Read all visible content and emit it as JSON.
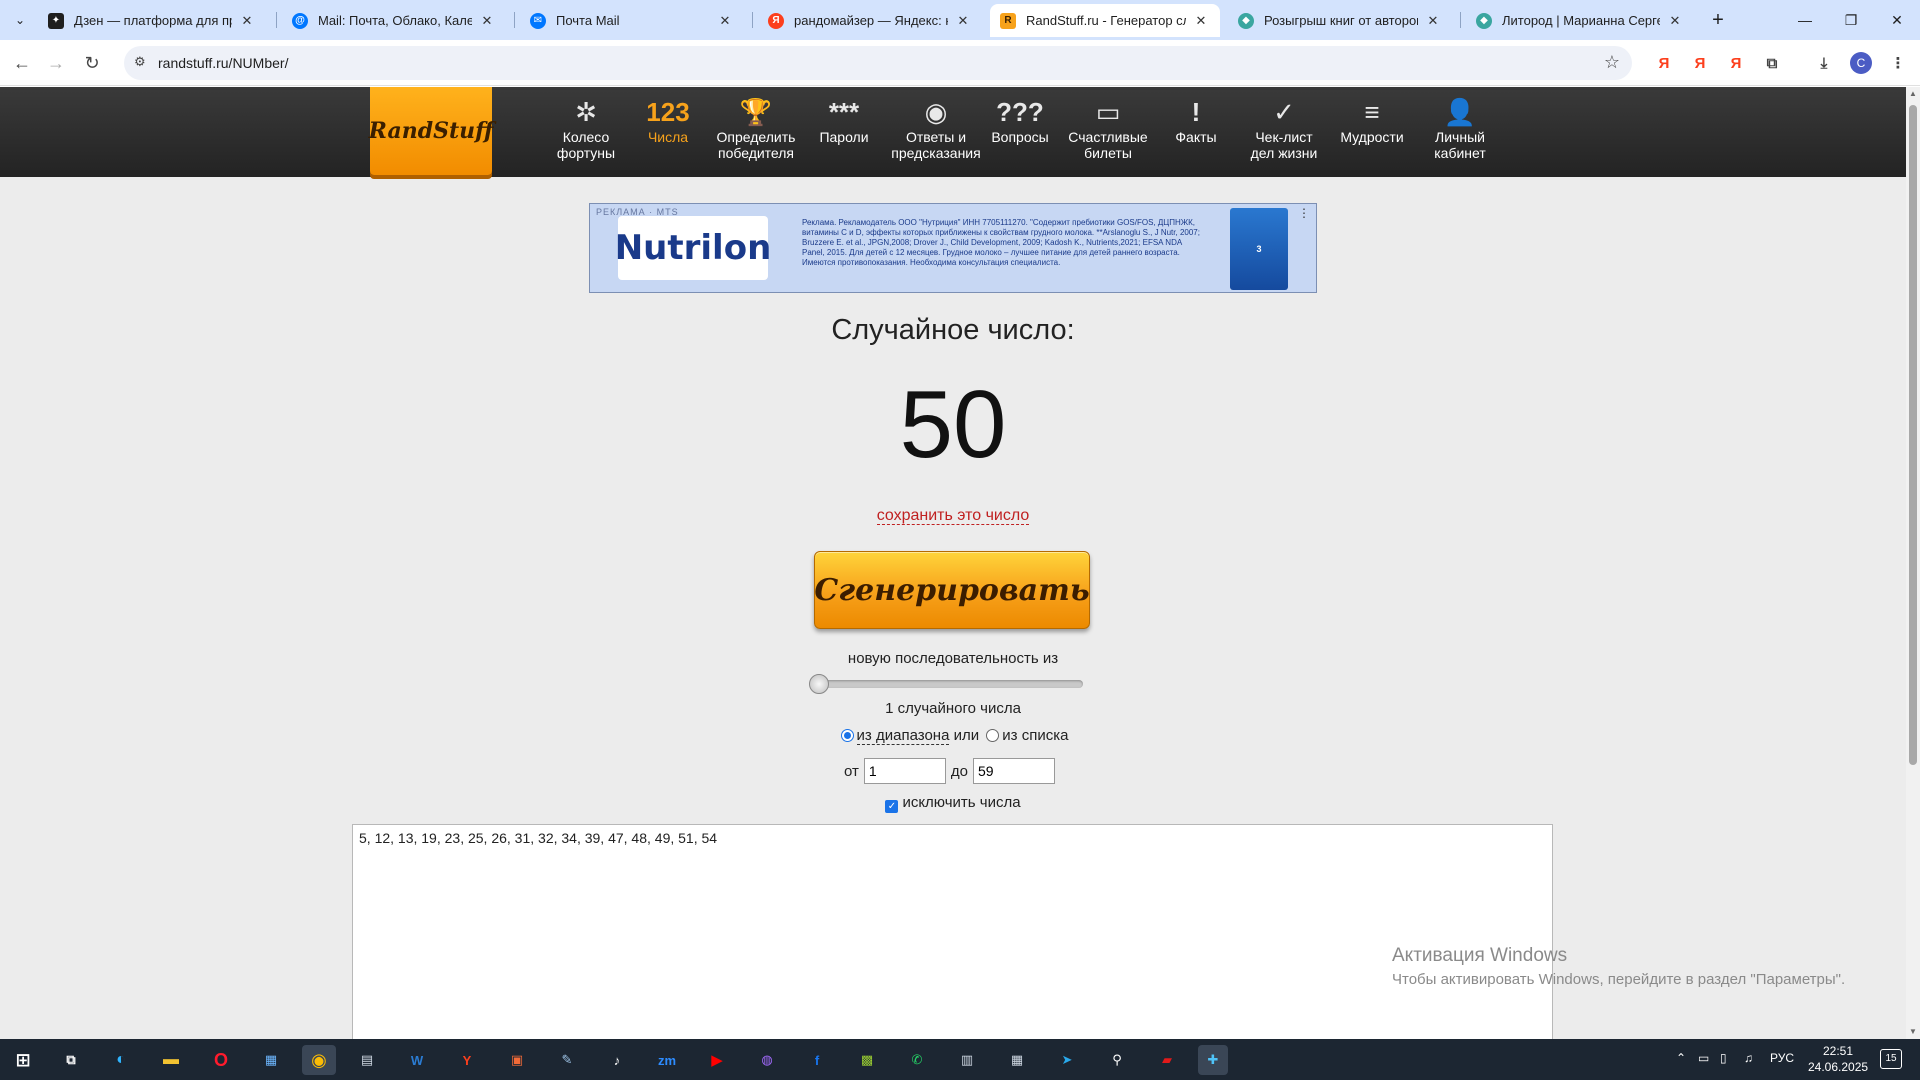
{
  "browser": {
    "tabs": [
      {
        "title": "Дзен — платформа для просм",
        "favicon": "zen-icon",
        "color": "#1f1f1f"
      },
      {
        "title": "Mail: Почта, Облако, Календар",
        "favicon": "mail-at-icon",
        "color": "#0077ff"
      },
      {
        "title": "Почта Mail",
        "favicon": "mail-envelope-icon",
        "color": "#0077ff"
      },
      {
        "title": "рандомайзер — Яндекс: нашл",
        "favicon": "yandex-icon",
        "color": "#fc3f1d"
      },
      {
        "title": "RandStuff.ru - Генератор случа",
        "favicon": "randstuff-icon",
        "color": "#f7a21b"
      },
      {
        "title": "Розыгрыш книг от авторов Ли",
        "favicon": "litres-icon",
        "color": "#3aa6a0"
      },
      {
        "title": "Литород | Марианна Сергеев",
        "favicon": "litres-icon",
        "color": "#3aa6a0"
      }
    ],
    "url": "randstuff.ru/NUMber/",
    "profile_initial": "С",
    "ext_label": "Я"
  },
  "site": {
    "logo": "RandStuff",
    "menu": [
      {
        "icon": "✲",
        "label1": "Колесо",
        "label2": "фортуны"
      },
      {
        "icon": "123",
        "label1": "Числа",
        "label2": ""
      },
      {
        "icon": "🏆",
        "label1": "Определить",
        "label2": "победителя"
      },
      {
        "icon": "***",
        "label1": "Пароли",
        "label2": ""
      },
      {
        "icon": "◉",
        "label1": "Ответы и",
        "label2": "предсказания"
      },
      {
        "icon": "???",
        "label1": "Вопросы",
        "label2": ""
      },
      {
        "icon": "▭",
        "label1": "Счастливые",
        "label2": "билеты"
      },
      {
        "icon": "!",
        "label1": "Факты",
        "label2": ""
      },
      {
        "icon": "✓",
        "label1": "Чек-лист",
        "label2": "дел жизни"
      },
      {
        "icon": "≡",
        "label1": "Мудрости",
        "label2": ""
      },
      {
        "icon": "👤",
        "label1": "Личный",
        "label2": "кабинет"
      }
    ],
    "active_menu": 1,
    "accent_color": "#f7a21b"
  },
  "ad": {
    "tag": "РЕКЛАМА · MTS",
    "brand": "Nutrilon",
    "text": "Реклама. Рекламодатель ООО \"Нутриция\" ИНН 7705111270. \"Содержит пребиотики GOS/FOS, ДЦПНЖК, витамины С и D, эффекты которых приближены к свойствам грудного молока. **Arslanoglu S., J Nutr, 2007; Bruzzere E. et al., JPGN,2008; Drover J., Child Development, 2009; Kadosh K., Nutrients,2021; EFSA NDA Panel, 2015. Для детей с 12 месяцев. Грудное молоко – лучшее питание для детей раннего возраста. Имеются противопоказания. Необходима консультация специалиста.",
    "pack_label": "3"
  },
  "generator": {
    "heading": "Случайное число:",
    "result": "50",
    "save_link": "сохранить это число",
    "button": "Сгенерировать",
    "sequence_label": "новую последовательность из",
    "count_label": "1 случайного числа",
    "slider_fraction": 0,
    "mode_range": "из диапазона",
    "mode_or": "или",
    "mode_list": "из списка",
    "from_label": "от",
    "from_value": "1",
    "to_label": "до",
    "to_value": "59",
    "exclude_label": "исключить числа",
    "excluded": "5, 12, 13, 19, 23, 25, 26, 31, 32, 34, 39, 47, 48, 49, 51, 54"
  },
  "watermark": {
    "line1": "Активация Windows",
    "line2": "Чтобы активировать Windows, перейдите в раздел \"Параметры\"."
  },
  "taskbar": {
    "lang": "РУС",
    "time": "22:51",
    "date": "24.06.2025",
    "notifications": "15"
  }
}
